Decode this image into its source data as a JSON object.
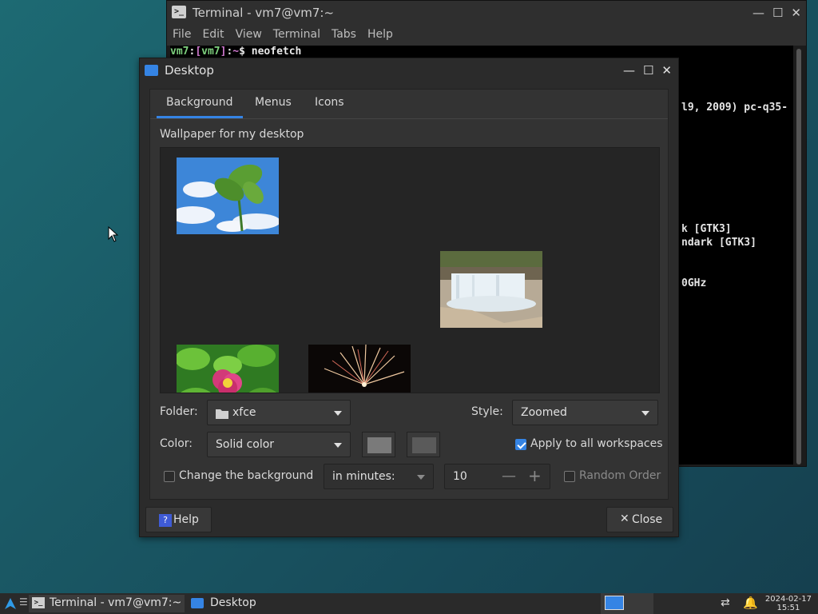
{
  "terminal": {
    "title": "Terminal - vm7@vm7:~",
    "menu": [
      "File",
      "Edit",
      "View",
      "Terminal",
      "Tabs",
      "Help"
    ],
    "prompt_user": "vm7",
    "prompt_host": "vm7",
    "prompt_dir": "~",
    "command": "neofetch",
    "lines": [
      "l9, 2009) pc-q35-",
      "k [GTK3]",
      "ndark [GTK3]",
      "0GHz"
    ]
  },
  "dialog": {
    "title": "Desktop",
    "tabs": [
      "Background",
      "Menus",
      "Icons"
    ],
    "wallpaper_label": "Wallpaper for my desktop",
    "folder_label": "Folder:",
    "folder_value": "xfce",
    "style_label": "Style:",
    "style_value": "Zoomed",
    "color_label": "Color:",
    "color_value": "Solid color",
    "apply_all_label": "Apply to all workspaces",
    "apply_all_checked": true,
    "change_bg_label": "Change the background",
    "interval_unit": "in minutes:",
    "interval_value": "10",
    "random_order_label": "Random Order",
    "help_label": "Help",
    "close_label": "Close",
    "colors": {
      "swatch1": "#7a7a7a",
      "swatch2": "#5a5a5a",
      "accent": "#3584e4"
    }
  },
  "taskbar": {
    "tasks": [
      "Terminal - vm7@vm7:~",
      "Desktop"
    ],
    "date": "2024-02-17",
    "time": "15:51"
  }
}
